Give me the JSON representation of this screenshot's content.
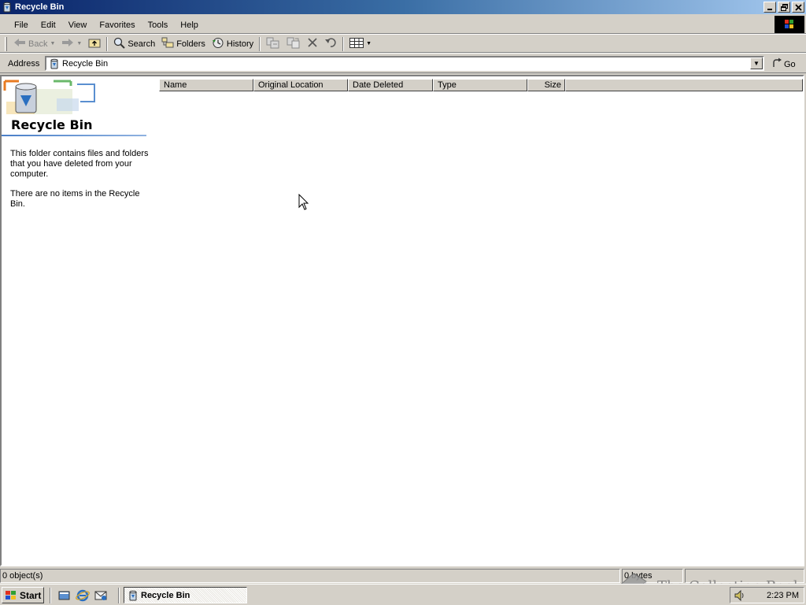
{
  "window": {
    "title": "Recycle Bin"
  },
  "menu": [
    "File",
    "Edit",
    "View",
    "Favorites",
    "Tools",
    "Help"
  ],
  "toolbar": {
    "back": "Back",
    "search": "Search",
    "folders": "Folders",
    "history": "History"
  },
  "address": {
    "label": "Address",
    "value": "Recycle Bin",
    "go": "Go"
  },
  "left_pane": {
    "title": "Recycle Bin",
    "description": "This folder contains files and folders that you have deleted from your computer.",
    "empty_message": "There are no items in the Recycle Bin."
  },
  "list": {
    "columns": [
      "Name",
      "Original Location",
      "Date Deleted",
      "Type",
      "Size"
    ]
  },
  "status": {
    "objects": "0 object(s)",
    "size": "0 bytes"
  },
  "watermark": "The Collection Book",
  "taskbar": {
    "start": "Start",
    "task": "Recycle Bin",
    "clock": "2:23 PM"
  },
  "colors": {
    "titlebar_start": "#0a246a",
    "titlebar_end": "#a6caf0",
    "face": "#d4d0c8"
  }
}
